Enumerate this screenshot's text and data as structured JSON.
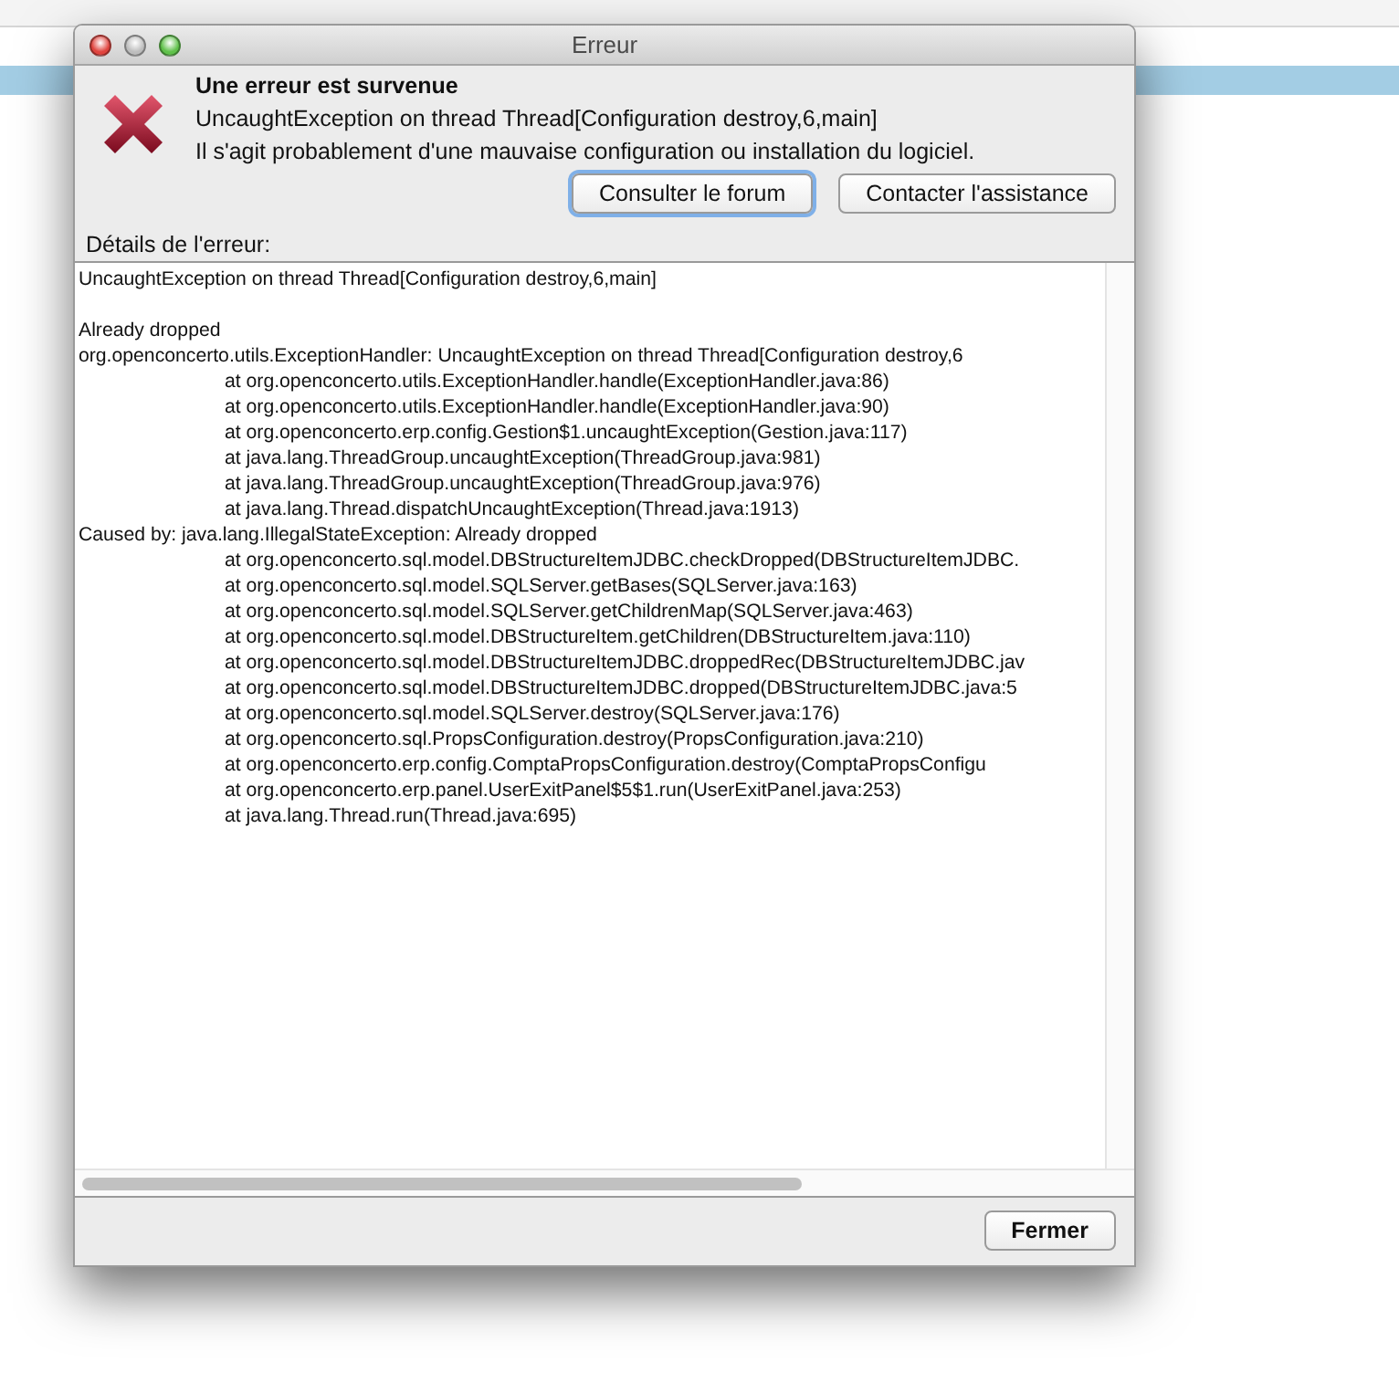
{
  "window": {
    "title": "Erreur"
  },
  "header": {
    "title": "Une erreur est survenue",
    "message": "UncaughtException on thread Thread[Configuration destroy,6,main]",
    "hint": "Il s'agit probablement d'une mauvaise configuration ou installation du logiciel."
  },
  "actions": [
    {
      "label": "Consulter le forum",
      "focused": true
    },
    {
      "label": "Contacter l'assistance",
      "focused": false
    }
  ],
  "details": {
    "label": "Détails de l'erreur:",
    "summary": "UncaughtException on thread Thread[Configuration destroy,6,main]",
    "trace": [
      {
        "kind": "message",
        "text": "Already dropped"
      },
      {
        "kind": "message",
        "text": "org.openconcerto.utils.ExceptionHandler: UncaughtException on thread Thread[Configuration destroy,6"
      },
      {
        "kind": "frame",
        "text": "at org.openconcerto.utils.ExceptionHandler.handle(ExceptionHandler.java:86)"
      },
      {
        "kind": "frame",
        "text": "at org.openconcerto.utils.ExceptionHandler.handle(ExceptionHandler.java:90)"
      },
      {
        "kind": "frame",
        "text": "at org.openconcerto.erp.config.Gestion$1.uncaughtException(Gestion.java:117)"
      },
      {
        "kind": "frame",
        "text": "at java.lang.ThreadGroup.uncaughtException(ThreadGroup.java:981)"
      },
      {
        "kind": "frame",
        "text": "at java.lang.ThreadGroup.uncaughtException(ThreadGroup.java:976)"
      },
      {
        "kind": "frame",
        "text": "at java.lang.Thread.dispatchUncaughtException(Thread.java:1913)"
      },
      {
        "kind": "message",
        "text": "Caused by: java.lang.IllegalStateException: Already dropped"
      },
      {
        "kind": "frame",
        "text": "at org.openconcerto.sql.model.DBStructureItemJDBC.checkDropped(DBStructureItemJDBC."
      },
      {
        "kind": "frame",
        "text": "at org.openconcerto.sql.model.SQLServer.getBases(SQLServer.java:163)"
      },
      {
        "kind": "frame",
        "text": "at org.openconcerto.sql.model.SQLServer.getChildrenMap(SQLServer.java:463)"
      },
      {
        "kind": "frame",
        "text": "at org.openconcerto.sql.model.DBStructureItem.getChildren(DBStructureItem.java:110)"
      },
      {
        "kind": "frame",
        "text": "at org.openconcerto.sql.model.DBStructureItemJDBC.droppedRec(DBStructureItemJDBC.jav"
      },
      {
        "kind": "frame",
        "text": "at org.openconcerto.sql.model.DBStructureItemJDBC.dropped(DBStructureItemJDBC.java:5"
      },
      {
        "kind": "frame",
        "text": "at org.openconcerto.sql.model.SQLServer.destroy(SQLServer.java:176)"
      },
      {
        "kind": "frame",
        "text": "at org.openconcerto.sql.PropsConfiguration.destroy(PropsConfiguration.java:210)"
      },
      {
        "kind": "frame",
        "text": "at org.openconcerto.erp.config.ComptaPropsConfiguration.destroy(ComptaPropsConfigu"
      },
      {
        "kind": "frame",
        "text": "at org.openconcerto.erp.panel.UserExitPanel$5$1.run(UserExitPanel.java:253)"
      },
      {
        "kind": "frame",
        "text": "at java.lang.Thread.run(Thread.java:695)"
      }
    ]
  },
  "footer": {
    "close_label": "Fermer"
  }
}
